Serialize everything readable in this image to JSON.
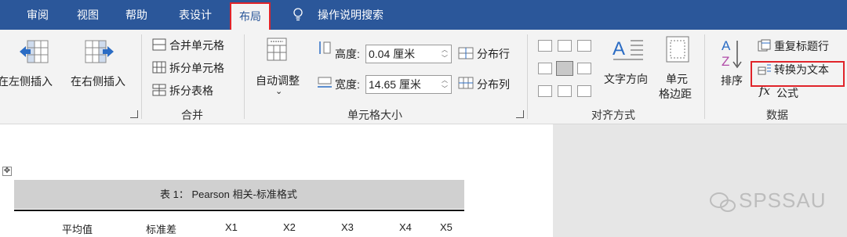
{
  "tabs": [
    "审阅",
    "视图",
    "帮助",
    "表设计",
    "布局"
  ],
  "active_tab": "布局",
  "tell_me": "操作说明搜索",
  "rows_cols": {
    "insert_left": "在左侧插入",
    "insert_right": "在右侧插入"
  },
  "merge": {
    "merge_cells": "合并单元格",
    "split_cells": "拆分单元格",
    "split_table": "拆分表格",
    "group": "合并"
  },
  "cell_size": {
    "autofit": "自动调整",
    "height_label": "高度:",
    "height_value": "0.04 厘米",
    "width_label": "宽度:",
    "width_value": "14.65 厘米",
    "distribute_rows": "分布行",
    "distribute_cols": "分布列",
    "group": "单元格大小"
  },
  "alignment": {
    "text_direction": "文字方向",
    "cell_margins_line1": "单元",
    "cell_margins_line2": "格边距",
    "group": "对齐方式"
  },
  "data": {
    "sort": "排序",
    "repeat_header": "重复标题行",
    "convert_text": "转换为文本",
    "formula": "公式",
    "group": "数据"
  },
  "document": {
    "table_title": "表 1： Pearson 相关-标准格式",
    "headers": [
      "平均值",
      "标准差",
      "X1",
      "X2",
      "X3",
      "X4",
      "X5"
    ]
  },
  "watermark": "SPSSAU",
  "colors": {
    "ribbon_tab_bar": "#2b579a",
    "highlight": "#e0242a",
    "accent": "#2b579a"
  }
}
